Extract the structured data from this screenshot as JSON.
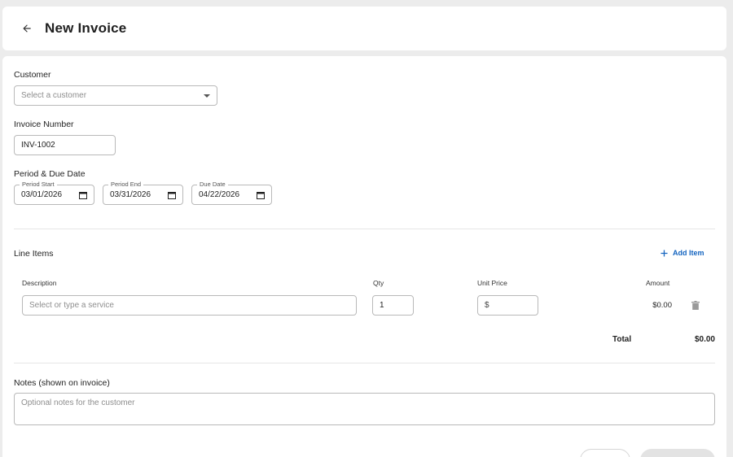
{
  "header": {
    "title": "New Invoice"
  },
  "customer": {
    "label": "Customer",
    "placeholder": "Select a customer"
  },
  "invoice_number": {
    "label": "Invoice Number",
    "value": "INV-1002"
  },
  "period": {
    "label": "Period & Due Date",
    "start": {
      "legend": "Period Start",
      "value": "03/01/2026"
    },
    "end": {
      "legend": "Period End",
      "value": "03/31/2026"
    },
    "due": {
      "legend": "Due Date",
      "value": "04/22/2026"
    }
  },
  "line_items": {
    "label": "Line Items",
    "add_label": "Add Item",
    "columns": {
      "description": "Description",
      "qty": "Qty",
      "unit_price": "Unit Price",
      "amount": "Amount"
    },
    "rows": [
      {
        "description_placeholder": "Select or type a service",
        "qty": "1",
        "currency": "$",
        "amount": "$0.00"
      }
    ],
    "total_label": "Total",
    "total_value": "$0.00"
  },
  "notes": {
    "label": "Notes (shown on invoice)",
    "placeholder": "Optional notes for the customer"
  },
  "colors": {
    "accent": "#1565c0",
    "border": "#b9b9b9",
    "background": "#ececec"
  }
}
